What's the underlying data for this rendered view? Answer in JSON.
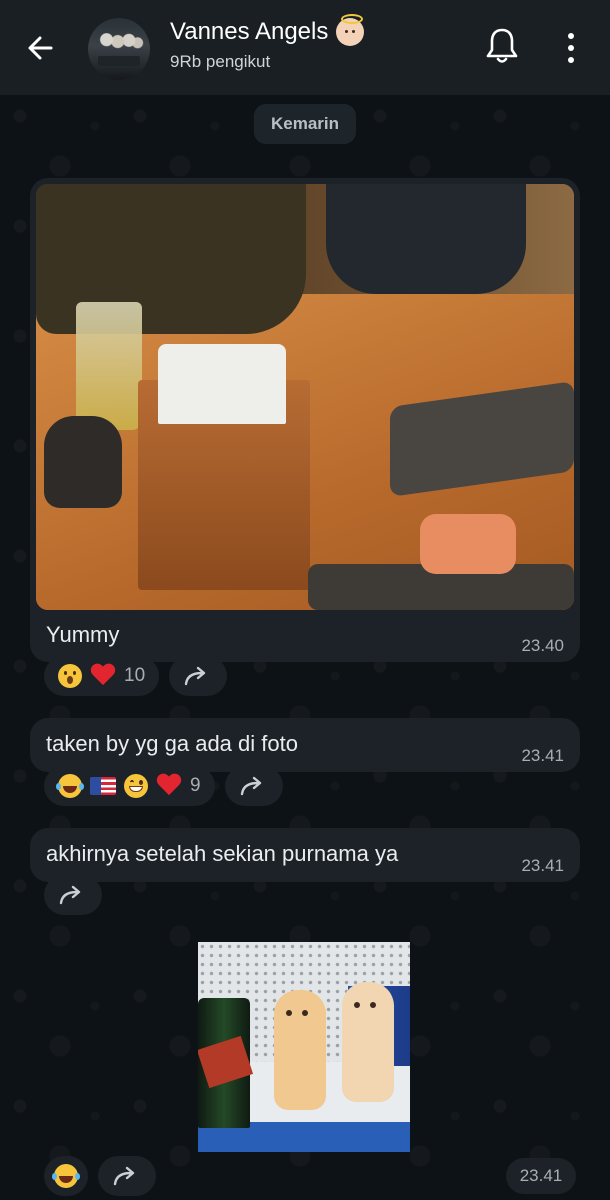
{
  "header": {
    "title": "Vannes Angels",
    "title_emoji": "baby-angel-icon",
    "subtitle": "9Rb pengikut"
  },
  "date_chip": "Kemarin",
  "messages": [
    {
      "type": "photo",
      "caption": "Yummy",
      "time": "23.40",
      "reactions": [
        {
          "icon": "surprised-face-icon"
        },
        {
          "icon": "red-heart-icon"
        }
      ],
      "reaction_count": "10"
    },
    {
      "type": "text",
      "text": "taken by yg ga ada di foto",
      "time": "23.41",
      "reactions": [
        {
          "icon": "tears-of-joy-icon"
        },
        {
          "icon": "us-flag-icon"
        },
        {
          "icon": "grinning-face-icon"
        },
        {
          "icon": "red-heart-icon"
        }
      ],
      "reaction_count": "9"
    },
    {
      "type": "text",
      "text": "akhirnya setelah sekian purnama ya",
      "time": "23.41"
    },
    {
      "type": "sticker",
      "time": "23.41",
      "reactions": [
        {
          "icon": "tears-of-joy-icon"
        }
      ]
    }
  ],
  "colors": {
    "header_bg": "#1a1f23",
    "bubble_bg": "#1c2227",
    "time_text": "#a6afb5",
    "heart": "#e3252f"
  }
}
